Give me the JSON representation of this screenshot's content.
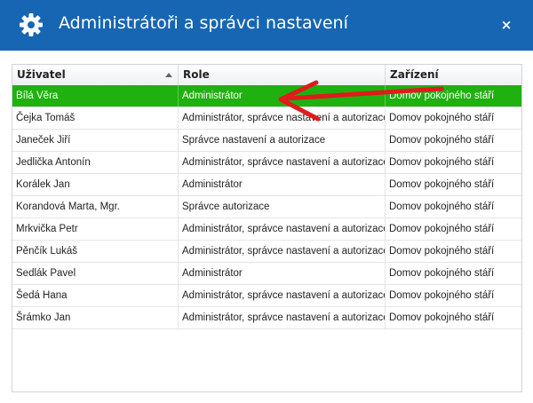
{
  "window": {
    "title": "Administrátoři a správci nastavení",
    "close_glyph": "×",
    "header_bg": "#1666b4"
  },
  "table": {
    "columns": [
      {
        "label": "Uživatel",
        "sort": "ascending"
      },
      {
        "label": "Role"
      },
      {
        "label": "Zařízení"
      }
    ],
    "selected_row_color": "#1fb10f",
    "rows": [
      {
        "user": "Bílá Věra",
        "role": "Administrátor",
        "facility": "Domov pokojného stáří",
        "selected": true
      },
      {
        "user": "Čejka Tomáš",
        "role": "Administrátor, správce nastavení a autorizace",
        "facility": "Domov pokojného stáří"
      },
      {
        "user": "Janeček Jiří",
        "role": "Správce nastavení a autorizace",
        "facility": "Domov pokojného stáří"
      },
      {
        "user": "Jedlička Antonín",
        "role": "Administrátor, správce nastavení a autorizace",
        "facility": "Domov pokojného stáří"
      },
      {
        "user": "Korálek Jan",
        "role": "Administrátor",
        "facility": "Domov pokojného stáří"
      },
      {
        "user": "Korandová Marta, Mgr.",
        "role": "Správce autorizace",
        "facility": "Domov pokojného stáří"
      },
      {
        "user": "Mrkvička Petr",
        "role": "Administrátor, správce nastavení a autorizace",
        "facility": "Domov pokojného stáří"
      },
      {
        "user": "Pěnčík Lukáš",
        "role": "Administrátor, správce nastavení a autorizace",
        "facility": "Domov pokojného stáří"
      },
      {
        "user": "Sedlák Pavel",
        "role": "Administrátor",
        "facility": "Domov pokojného stáří"
      },
      {
        "user": "Šedá Hana",
        "role": "Administrátor, správce nastavení a autorizace",
        "facility": "Domov pokojného stáří"
      },
      {
        "user": "Šrámko Jan",
        "role": "Administrátor, správce nastavení a autorizace",
        "facility": "Domov pokojného stáří"
      }
    ]
  },
  "annotation": {
    "icon": "red-arrow-icon",
    "color": "#e01b1b"
  }
}
